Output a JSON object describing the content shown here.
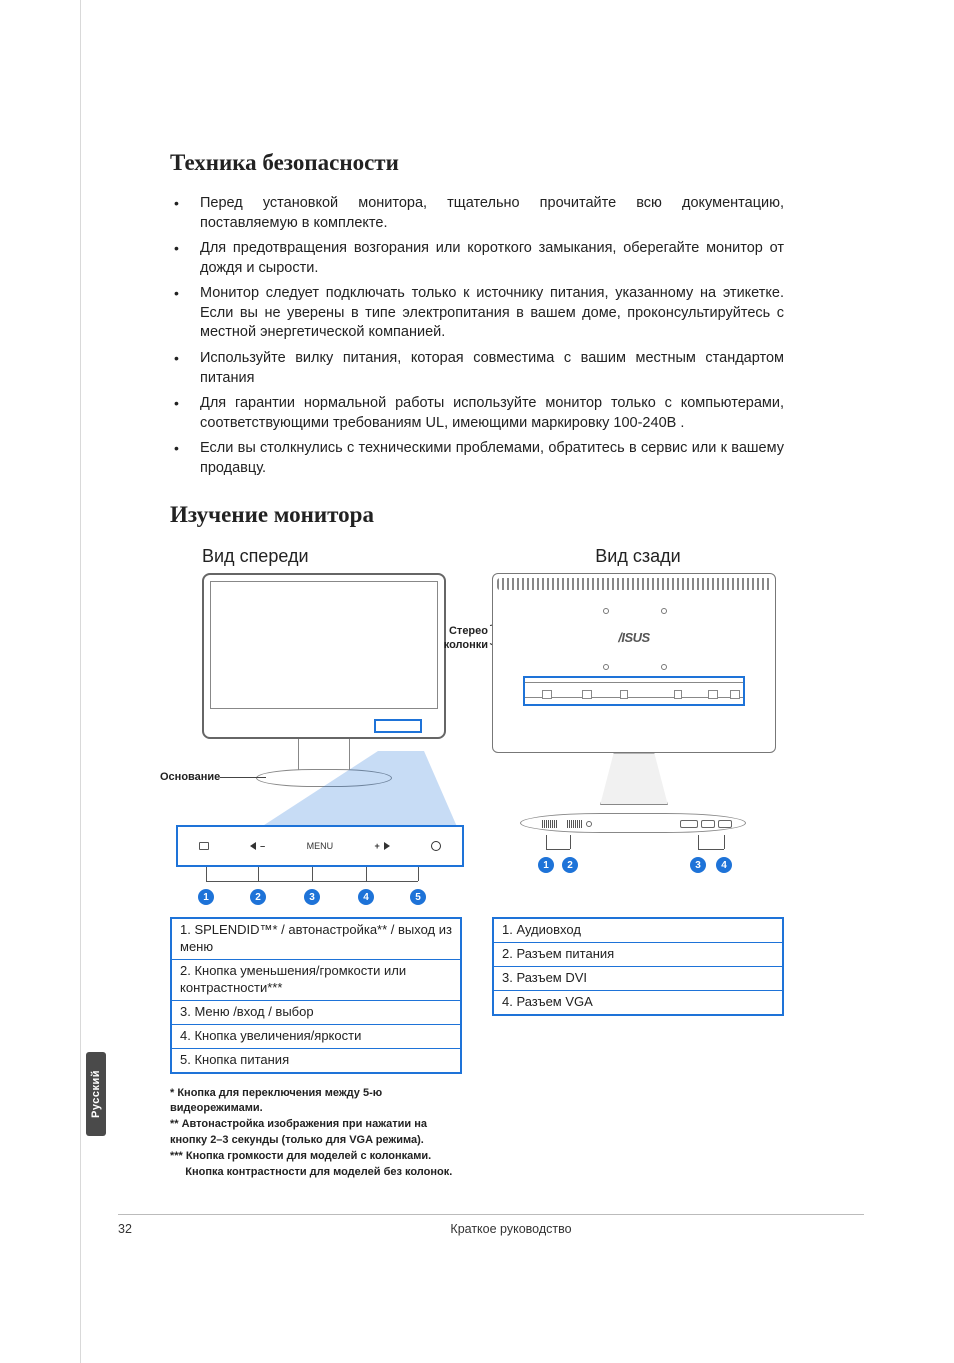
{
  "sections": {
    "safety_heading": "Техника безопасности",
    "study_heading": "Изучение монитора"
  },
  "safety_items": [
    "Перед установкой монитора, тщательно прочитайте всю документацию, поставляемую в комплекте.",
    "Для предотвращения возгорания или короткого замыкания, оберегайте монитор от дождя и сырости.",
    "Монитор следует подключать только к источнику питания, указанному на этикетке. Если вы не уверены в типе электропитания в вашем доме, проконсультируйтесь с местной энергетической компанией.",
    "Используйте вилку питания, которая совместима с вашим местным стандартом питания",
    "Для гарантии нормальной работы используйте монитор только с компьютерами, соответствующими требованиям UL, имеющими маркировку 100-240В .",
    "Если вы столкнулись с техническими проблемами, обратитесь в сервис или к вашему продавцу."
  ],
  "views": {
    "front_title": "Вид спереди",
    "rear_title": "Вид сзади"
  },
  "labels": {
    "base": "Основание",
    "stereo_line1": "Стерео",
    "stereo_line2": "колонки",
    "menu_btn": "MENU",
    "logo": "/ISUS"
  },
  "front_numbers": [
    "1",
    "2",
    "3",
    "4",
    "5"
  ],
  "rear_numbers": [
    "1",
    "2",
    "3",
    "4"
  ],
  "front_legend": [
    "1. SPLENDID™* / автонастройка** / выход из меню",
    "2.  Кнопка уменьшения/громкости или контрастности***",
    "3. Меню /вход / выбор",
    "4. Кнопка увеличения/яркости",
    "5. Кнопка питания"
  ],
  "rear_legend": [
    "1. Аудиовход",
    "2. Разъем питания",
    "3. Разъем DVI",
    "4. Разъем VGA"
  ],
  "footnotes": [
    "* Кнопка для переключения между 5-ю видеорежимами.",
    "** Автонастройка изображения при нажатии на кнопку 2–3 секунды  (только для VGA режима).",
    "*** Кнопка громкости для моделей с колонками.",
    "     Кнопка контрастности для моделей без колонок."
  ],
  "side_tab": "Русский",
  "footer": {
    "page": "32",
    "title": "Краткое руководство"
  }
}
